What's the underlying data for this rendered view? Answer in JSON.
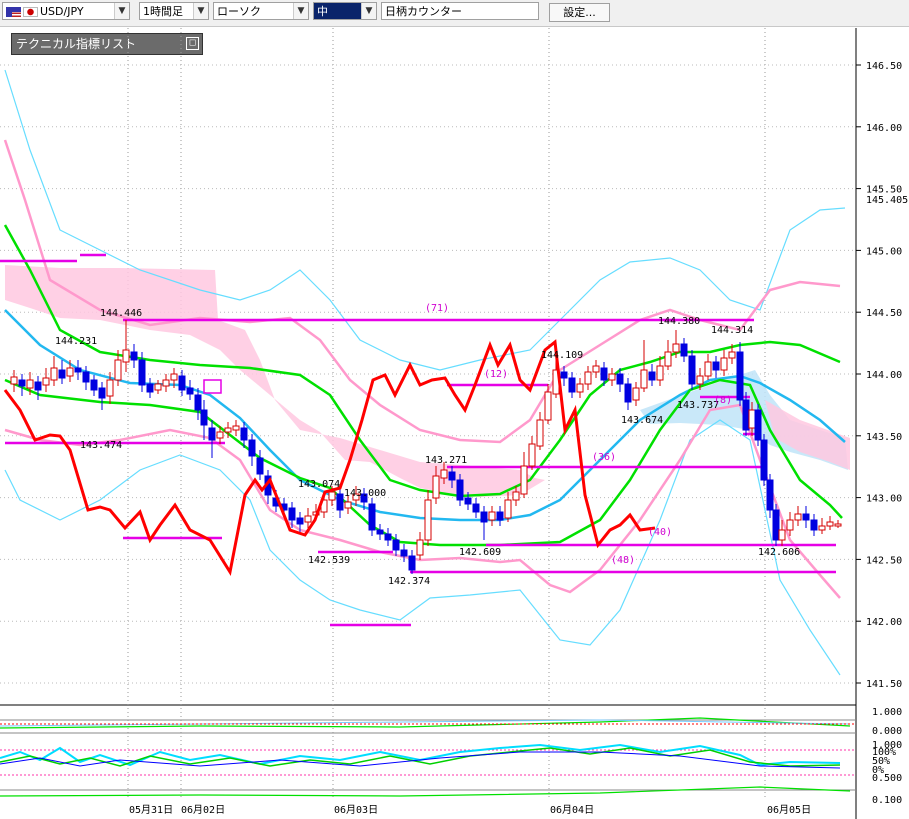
{
  "toolbar": {
    "pair": "USD/JPY",
    "timeframe": "1時間足",
    "chart_type": "ローソク",
    "size": "中",
    "counter": "日柄カウンター",
    "settings": "設定..."
  },
  "indicator_panel": {
    "title": "テクニカル指標リスト",
    "toggle": "◻"
  },
  "colors": {
    "up": "#d40000",
    "down": "#0000e0",
    "rsi": "#ff0000",
    "ma_short": "#00e000",
    "ma_long": "#00aaff",
    "bb_inner": "#ff99cc",
    "bb_outer": "#66ddff",
    "cloud": "#ffc8e0",
    "counter_line": "#e600e6"
  },
  "chart_data": {
    "type": "candlestick",
    "y_ticks": [
      "146.50",
      "146.00",
      "145.50",
      "145.00",
      "144.50",
      "144.00",
      "143.50",
      "143.00",
      "142.50",
      "142.00",
      "141.50"
    ],
    "current_price": "145.405",
    "x_labels": [
      "05月31日",
      "06月02日",
      "06月03日",
      "06月04日",
      "06月05日"
    ],
    "price_labels": [
      "144.446",
      "144.231",
      "143.474",
      "143.074",
      "143.000",
      "142.539",
      "142.374",
      "143.271",
      "142.609",
      "144.109",
      "144.380",
      "144.314",
      "143.674",
      "143.737",
      "142.606"
    ],
    "counter_labels": [
      "(71)",
      "(12)",
      "(36)",
      "(48)",
      "(40)",
      "(8)"
    ],
    "sub_ticks_1": [
      "1.000",
      "0.000"
    ],
    "sub_ticks_2": [
      "1.000",
      "100%",
      "50%",
      "0%",
      "0.500"
    ],
    "sub_ticks_3": [
      "0.100"
    ]
  }
}
